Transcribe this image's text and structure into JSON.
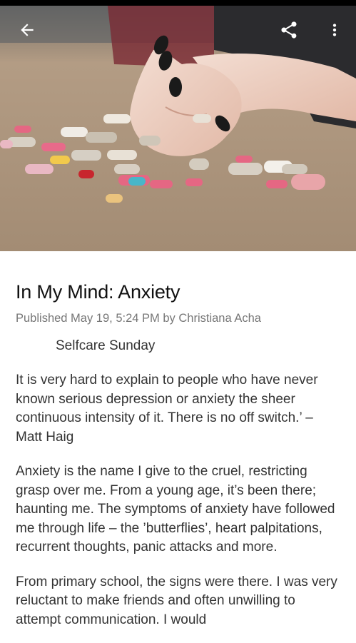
{
  "toolbar": {
    "back_icon": "arrow-back-icon",
    "share_icon": "share-icon",
    "more_icon": "more-vertical-icon"
  },
  "hero": {
    "image_name": "hero-image"
  },
  "article": {
    "title": "In My Mind: Anxiety",
    "meta": "Published May 19, 5:24 PM by Christiana Acha",
    "tagline": "Selfcare Sunday",
    "paragraphs": [
      "It is very hard to explain to people who have never known serious depression or anxiety the sheer continuous intensity of it. There is no off switch.’ – Matt Haig",
      "Anxiety is the name I give to the cruel, restricting grasp over me.  From a young age, it’s been there; haunting me. The symptoms of anxiety have followed me through life – the ’butterflies’, heart palpitations, recurrent thoughts, panic attacks and more.",
      "From primary school, the signs were there. I was very reluctant to make friends and often unwilling to attempt communication. I would"
    ]
  }
}
